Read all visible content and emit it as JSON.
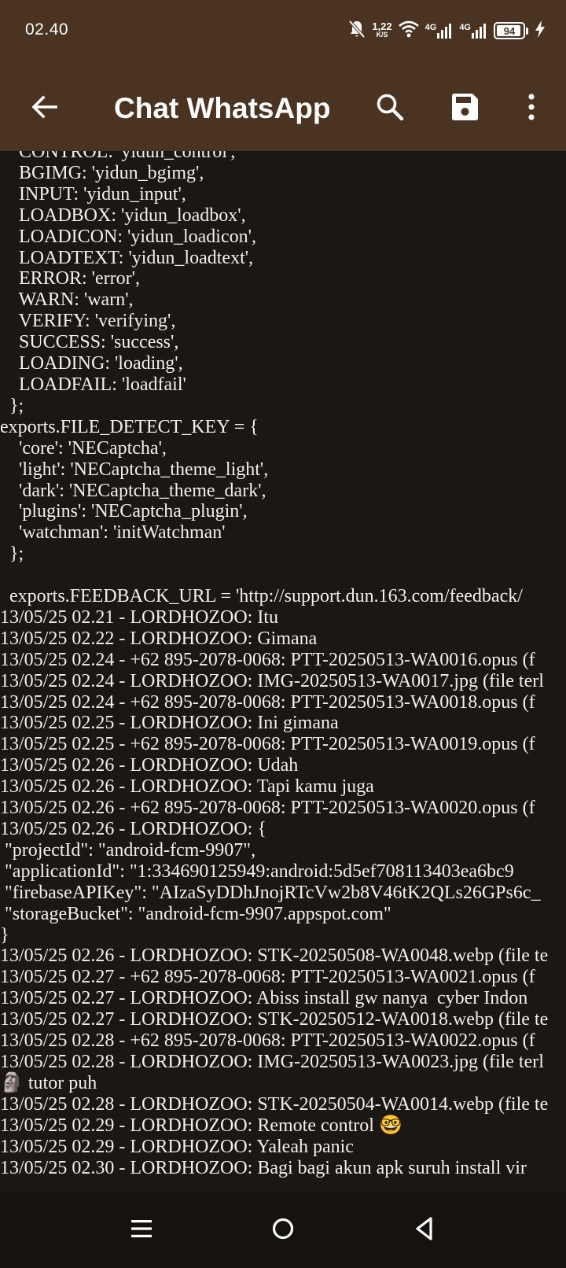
{
  "status_bar": {
    "time": "02.40",
    "net_speed_value": "1,22",
    "net_speed_unit": "K/S",
    "network_1": "4G",
    "network_2": "4G",
    "battery_level": "94",
    "battery_fraction": 0.94,
    "icons": [
      "dnd-bell-off-icon",
      "wifi-icon",
      "signal-4g-icon",
      "signal-4g-icon",
      "battery-icon",
      "charging-bolt-icon"
    ]
  },
  "toolbar": {
    "title": "Chat WhatsApp",
    "icons": [
      "back-arrow-icon",
      "search-icon",
      "save-icon",
      "more-vert-icon"
    ],
    "background": "#4a3320"
  },
  "content": {
    "lines": [
      "    CONTROL: 'yidun_control',",
      "    BGIMG: 'yidun_bgimg',",
      "    INPUT: 'yidun_input',",
      "    LOADBOX: 'yidun_loadbox',",
      "    LOADICON: 'yidun_loadicon',",
      "    LOADTEXT: 'yidun_loadtext',",
      "    ERROR: 'error',",
      "    WARN: 'warn',",
      "    VERIFY: 'verifying',",
      "    SUCCESS: 'success',",
      "    LOADING: 'loading',",
      "    LOADFAIL: 'loadfail'",
      "  };",
      "exports.FILE_DETECT_KEY = {",
      "    'core': 'NECaptcha',",
      "    'light': 'NECaptcha_theme_light',",
      "    'dark': 'NECaptcha_theme_dark',",
      "    'plugins': 'NECaptcha_plugin',",
      "    'watchman': 'initWatchman'",
      "  };",
      "",
      "  exports.FEEDBACK_URL = 'http://support.dun.163.com/feedback/",
      "13/05/25 02.21 - LORDHOZOO: Itu",
      "13/05/25 02.22 - LORDHOZOO: Gimana",
      "13/05/25 02.24 - +62 895-2078-0068: PTT-20250513-WA0016.opus (f",
      "13/05/25 02.24 - LORDHOZOO: IMG-20250513-WA0017.jpg (file terl",
      "13/05/25 02.24 - +62 895-2078-0068: PTT-20250513-WA0018.opus (f",
      "13/05/25 02.25 - LORDHOZOO: Ini gimana",
      "13/05/25 02.25 - +62 895-2078-0068: PTT-20250513-WA0019.opus (f",
      "13/05/25 02.26 - LORDHOZOO: Udah",
      "13/05/25 02.26 - LORDHOZOO: Tapi kamu juga",
      "13/05/25 02.26 - +62 895-2078-0068: PTT-20250513-WA0020.opus (f",
      "13/05/25 02.26 - LORDHOZOO: {",
      " \"projectId\": \"android-fcm-9907\",",
      " \"applicationId\": \"1:334690125949:android:5d5ef708113403ea6bc9",
      " \"firebaseAPIKey\": \"AIzaSyDDhJnojRTcVw2b8V46tK2QLs26GPs6c_",
      " \"storageBucket\": \"android-fcm-9907.appspot.com\"",
      "}",
      "13/05/25 02.26 - LORDHOZOO: STK-20250508-WA0048.webp (file te",
      "13/05/25 02.27 - +62 895-2078-0068: PTT-20250513-WA0021.opus (f",
      "13/05/25 02.27 - LORDHOZOO: Abiss install gw nanya  cyber Indon",
      "13/05/25 02.27 - LORDHOZOO: STK-20250512-WA0018.webp (file te",
      "13/05/25 02.28 - +62 895-2078-0068: PTT-20250513-WA0022.opus (f",
      "13/05/25 02.28 - LORDHOZOO: IMG-20250513-WA0023.jpg (file terl",
      "🗿 tutor puh",
      "13/05/25 02.28 - LORDHOZOO: STK-20250504-WA0014.webp (file te",
      "13/05/25 02.29 - LORDHOZOO: Remote control 🤓",
      "13/05/25 02.29 - LORDHOZOO: Yaleah panic",
      "13/05/25 02.30 - LORDHOZOO: Bagi bagi akun apk suruh install vir"
    ]
  },
  "nav_bar": {
    "icons": [
      "recents-icon",
      "home-icon",
      "back-icon"
    ]
  }
}
